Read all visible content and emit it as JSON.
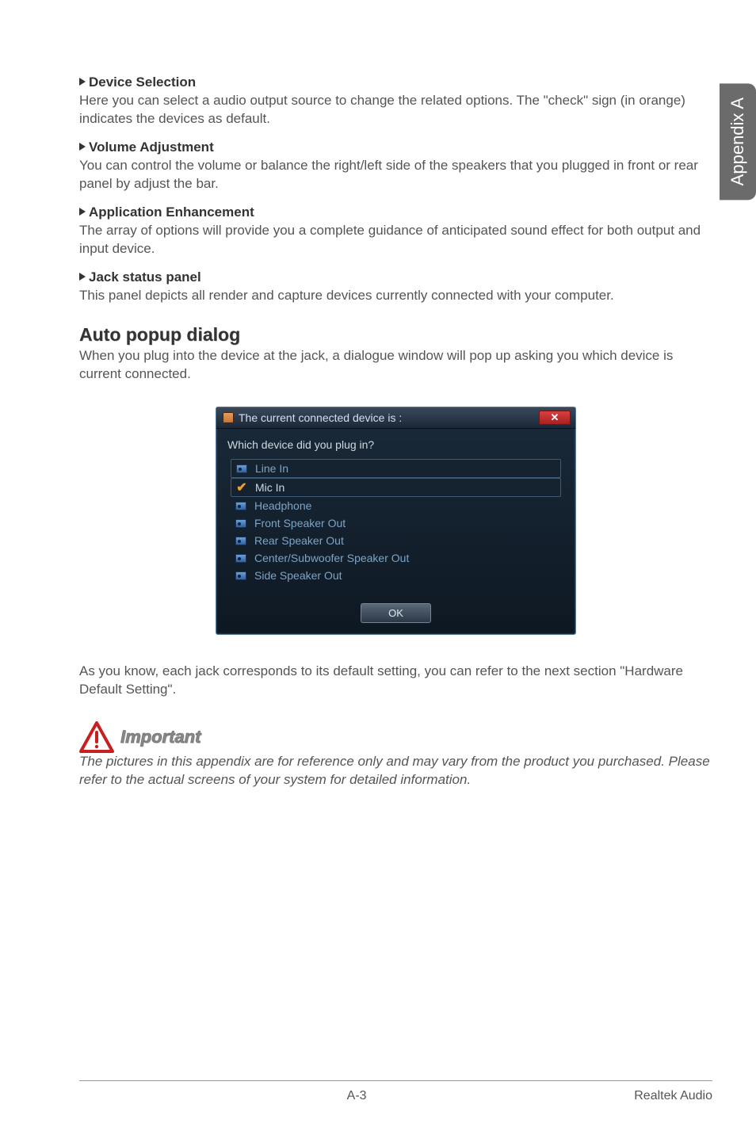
{
  "side_tab": "Appendix A",
  "sections": {
    "device_selection": {
      "heading": "Device Selection",
      "body": "Here you can select a audio output source to change the related options. The \"check\" sign (in orange) indicates the devices as default."
    },
    "volume_adjustment": {
      "heading": "Volume Adjustment",
      "body": "You can control the volume or balance the right/left side of the speakers that you plugged in front or rear panel by adjust the bar."
    },
    "application_enhancement": {
      "heading": "Application Enhancement",
      "body": "The array of options will provide you a complete guidance of anticipated sound effect for both output and input device."
    },
    "jack_status": {
      "heading": "Jack status panel",
      "body": "This panel depicts all render and capture devices currently connected with your computer."
    }
  },
  "auto_popup": {
    "title": "Auto popup dialog",
    "intro": "When you plug into the device at the jack, a dialogue window will pop up asking you which device is current connected."
  },
  "dialog": {
    "title": "The current connected device is :",
    "subtitle": "Which device did you plug in?",
    "close_glyph": "✕",
    "devices": [
      {
        "label": "Line In",
        "selected": false,
        "boxed": true
      },
      {
        "label": "Mic In",
        "selected": true,
        "boxed": true
      },
      {
        "label": "Headphone",
        "selected": false,
        "boxed": false
      },
      {
        "label": "Front Speaker Out",
        "selected": false,
        "boxed": false
      },
      {
        "label": "Rear Speaker Out",
        "selected": false,
        "boxed": false
      },
      {
        "label": "Center/Subwoofer Speaker Out",
        "selected": false,
        "boxed": false
      },
      {
        "label": "Side Speaker Out",
        "selected": false,
        "boxed": false
      }
    ],
    "ok_label": "OK"
  },
  "after_dialog": "As you know, each jack corresponds to its default setting, you can refer to the next section \"Hardware Default Setting\".",
  "important": {
    "label": "Important",
    "text": "The pictures in this appendix are for reference only and may vary from the product you purchased. Please refer to the actual screens of your system for detailed information."
  },
  "footer": {
    "page": "A-3",
    "section": "Realtek Audio"
  }
}
